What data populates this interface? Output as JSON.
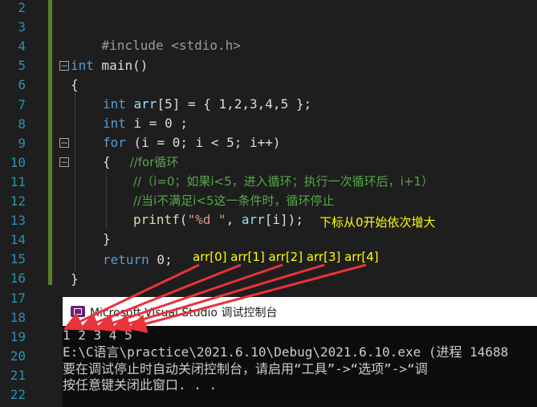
{
  "editor": {
    "line_numbers": [
      "2",
      "3",
      "4",
      "5",
      "6",
      "7",
      "8",
      "9",
      "10",
      "11",
      "12",
      "13",
      "14",
      "15",
      "16",
      "17",
      "18",
      "19",
      "20",
      "21",
      "22"
    ],
    "code": {
      "include": "#include <stdio.h>",
      "main_kw": "int",
      "main_rest": " main()",
      "open_brace": "{",
      "l7_kw": "int",
      "l7_var": " arr",
      "l7_rest": "[5] = { 1,2,3,4,5 };",
      "l8_kw": "int",
      "l8_rest": " i = 0 ;",
      "l9_kw": "for",
      "l9_rest": " (i = 0; i < 5; i++)",
      "l10_brace": "{",
      "l10_cmt": "//for循环",
      "l11_cmt": "//（i=0；如果i<5，进入循环；执行一次循环后，i+1）",
      "l12_cmt": "//当i不满足i<5这一条件时，循环停止",
      "l13_fn": "printf",
      "l13_open": "(",
      "l13_str": "\"%d \"",
      "l13_mid": ", ",
      "l13_var": "arr",
      "l13_rest": "[i]);",
      "l14_brace": "}",
      "l15_kw": "return",
      "l15_rest": " 0;",
      "l16_brace": "}"
    }
  },
  "annotations": {
    "subscript_note": "下标从0开始依次增大",
    "elements_note": "arr[0] arr[1] arr[2] arr[3] arr[4]"
  },
  "console": {
    "title": "Microsoft Visual Studio 调试控制台",
    "output_line": "1 2 3 4 5",
    "path_line": "E:\\C语言\\practice\\2021.6.10\\Debug\\2021.6.10.exe (进程 14688",
    "hint_line": "要在调试停止时自动关闭控制台，请启用“工具”->“选项”->“调",
    "close_line": "按任意键关闭此窗口. . ."
  },
  "colors": {
    "arrow": "#e8333b",
    "annotation": "#ffff00",
    "change_bar": "#577e2a"
  }
}
